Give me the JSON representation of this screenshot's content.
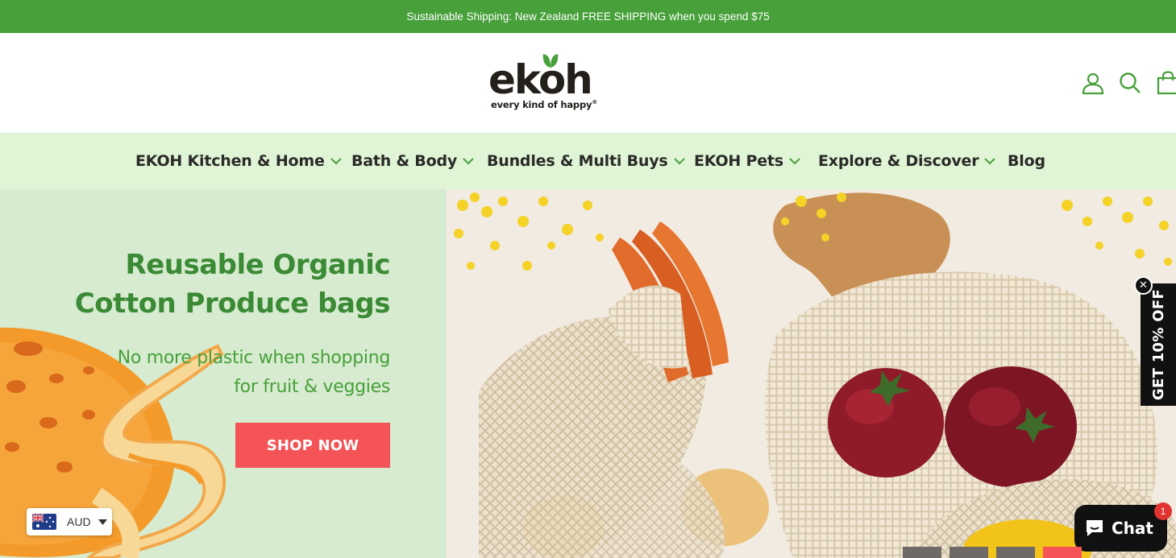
{
  "announcement": "Sustainable Shipping: New Zealand FREE SHIPPING when you spend $75",
  "brand": {
    "name": "ekoh",
    "tagline": "every kind of happy",
    "registered": "®"
  },
  "header_icons": [
    "account-icon",
    "search-icon",
    "cart-icon"
  ],
  "nav": [
    {
      "label": "EKOH Kitchen & Home",
      "has_dropdown": true
    },
    {
      "label": "Bath & Body",
      "has_dropdown": true
    },
    {
      "label": "Bundles & Multi Buys",
      "has_dropdown": true
    },
    {
      "label": "EKOH Pets",
      "has_dropdown": true
    },
    {
      "label": "Explore & Discover",
      "has_dropdown": true
    },
    {
      "label": "Blog",
      "has_dropdown": false
    }
  ],
  "hero": {
    "title_line1": "Reusable Organic",
    "title_line2": "Cotton Produce bags",
    "subtitle_line1": "No more plastic when shopping",
    "subtitle_line2": "for fruit & veggies",
    "cta": "SHOP NOW"
  },
  "promo_tab": {
    "label": "GET 10% OFF",
    "close": "✕"
  },
  "currency": {
    "code": "AUD",
    "flag": "australia-flag-icon"
  },
  "chat": {
    "label": "Chat",
    "badge": "1"
  },
  "slider": {
    "slide_count": 5,
    "active_index": 3
  },
  "colors": {
    "brand_green": "#47a03a",
    "title_green": "#3b8a35",
    "nav_bg": "#dff5d6",
    "hero_bg": "#d6ebcf",
    "cta_red": "#f55457",
    "text_dark": "#2b2a28"
  }
}
